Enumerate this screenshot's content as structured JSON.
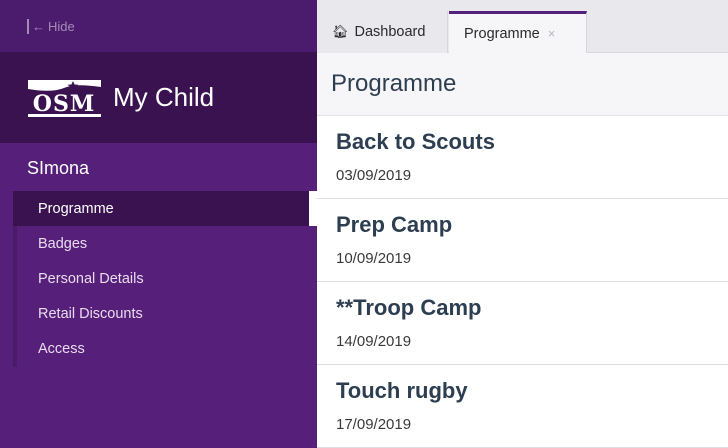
{
  "sidebar": {
    "hide_label": "Hide",
    "brand": {
      "logo_text": "OSM",
      "title": "My Child"
    },
    "member_name": "SImona",
    "nav_items": [
      {
        "label": "Programme",
        "active": true
      },
      {
        "label": "Badges"
      },
      {
        "label": "Personal Details"
      },
      {
        "label": "Retail Discounts"
      },
      {
        "label": "Access"
      }
    ]
  },
  "tabs": [
    {
      "label": "Dashboard",
      "icon": "home-icon"
    },
    {
      "label": "Programme",
      "closable": true
    }
  ],
  "page": {
    "title": "Programme",
    "events": [
      {
        "title": "Back to Scouts",
        "date": "03/09/2019"
      },
      {
        "title": "Prep Camp",
        "date": "10/09/2019"
      },
      {
        "title": "**Troop Camp",
        "date": "14/09/2019"
      },
      {
        "title": "Touch rugby",
        "date": "17/09/2019"
      }
    ]
  },
  "colors": {
    "sidebar_bg": "#56207a",
    "sidebar_dark": "#3a1250",
    "accent": "#55207a",
    "heading_text": "#2c3e50"
  }
}
